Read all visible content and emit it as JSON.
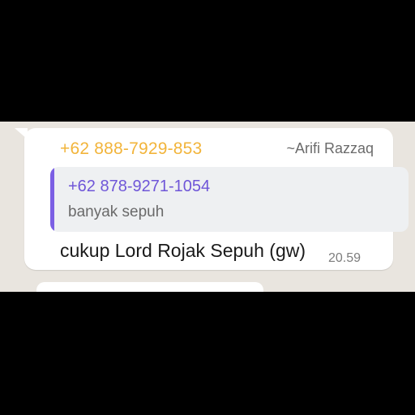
{
  "message": {
    "sender_number": "+62 888-7929-853",
    "sender_name": "~Arifi Razzaq",
    "quoted": {
      "number": "+62 878-9271-1054",
      "text": "banyak sepuh"
    },
    "text": "cukup Lord Rojak Sepuh (gw)",
    "time": "20.59"
  },
  "colors": {
    "sender_number": "#f2b43a",
    "quote_accent": "#7b5fe4",
    "chat_background": "#e9e5df",
    "bubble": "#ffffff"
  }
}
